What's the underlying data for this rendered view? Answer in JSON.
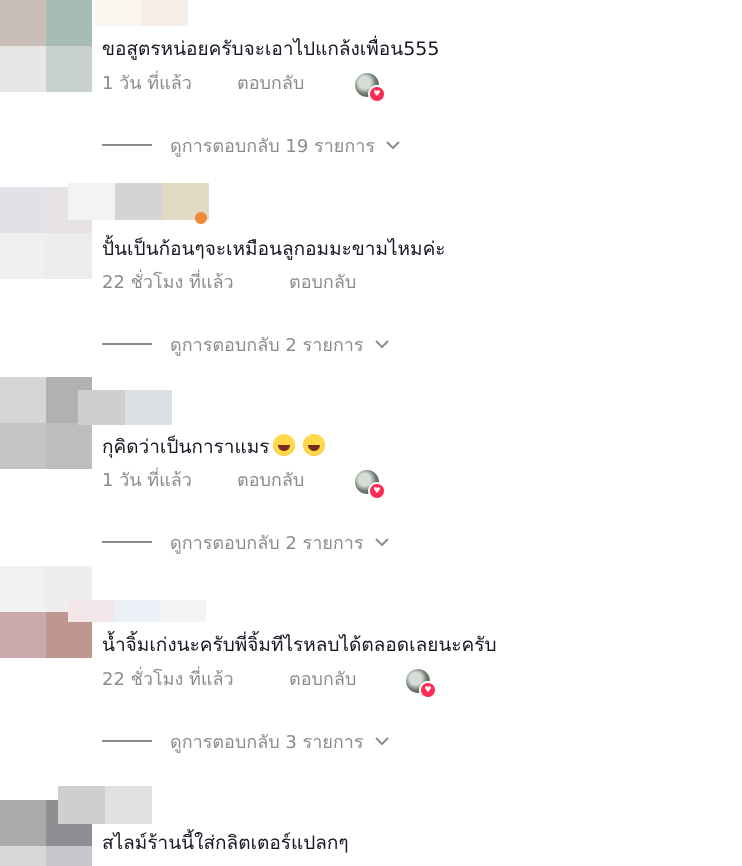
{
  "comments": [
    {
      "text": "ขอสูตรหน่อยครับจะเอาไปแกล้งเพื่อน555",
      "time": "1 วัน ที่แล้ว",
      "reply_label": "ตอบกลับ",
      "view_replies": "ดูการตอบกลับ 19 รายการ",
      "creator_liked": true
    },
    {
      "text": "ปั้นเป็นก้อนๆจะเหมือนลูกอมมะขามไหมค่ะ",
      "time": "22 ชั่วโมง ที่แล้ว",
      "reply_label": "ตอบกลับ",
      "view_replies": "ดูการตอบกลับ 2 รายการ",
      "creator_liked": false
    },
    {
      "text": "กุคิดว่าเป็นการาแมร",
      "time": "1 วัน ที่แล้ว",
      "reply_label": "ตอบกลับ",
      "view_replies": "ดูการตอบกลับ 2 รายการ",
      "creator_liked": true,
      "emojis": [
        "laughing-crying-emoji",
        "laughing-crying-emoji"
      ]
    },
    {
      "text": "น้ำจิ้มเก่งนะครับพี่จิ้มทีไรหลบได้ตลอดเลยนะครับ",
      "time": "22 ชั่วโมง ที่แล้ว",
      "reply_label": "ตอบกลับ",
      "view_replies": "ดูการตอบกลับ 3 รายการ",
      "creator_liked": true
    },
    {
      "text": "สไลม์ร้านนี้ใส่กลิตเตอร์แปลกๆ"
    }
  ],
  "colors": {
    "text": "#161823",
    "muted": "#8a8b91",
    "heart": "#fe2c55"
  }
}
